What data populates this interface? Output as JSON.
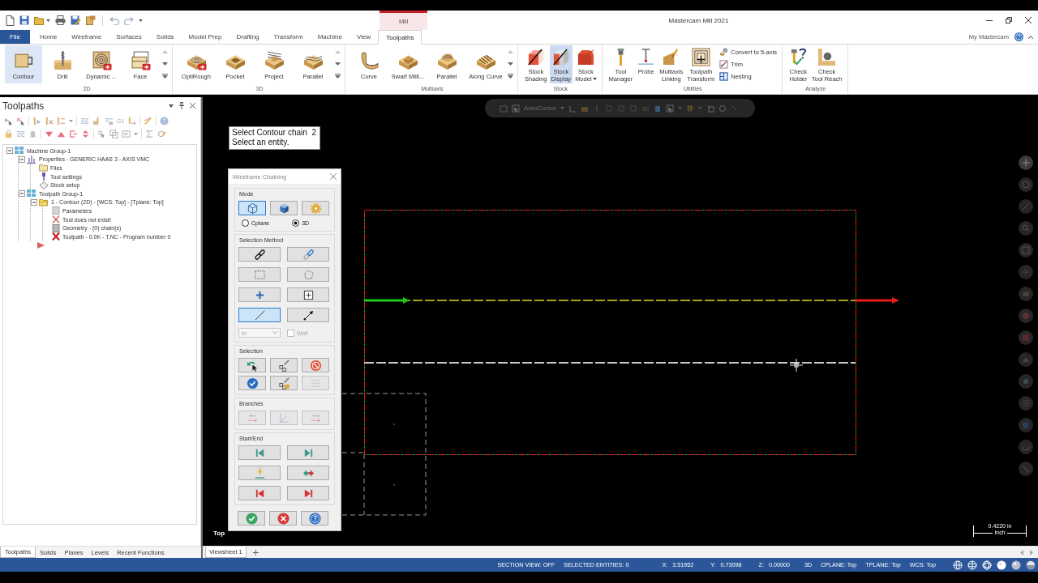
{
  "window": {
    "title": "Mastercam Mill 2021",
    "context_tab": "Mill"
  },
  "ribbon_tabs": [
    {
      "label": "File",
      "kind": "file",
      "selected": false
    },
    {
      "label": "Home",
      "kind": "tab",
      "selected": false
    },
    {
      "label": "Wireframe",
      "kind": "tab",
      "selected": false
    },
    {
      "label": "Surfaces",
      "kind": "tab",
      "selected": false
    },
    {
      "label": "Solids",
      "kind": "tab",
      "selected": false
    },
    {
      "label": "Model Prep",
      "kind": "tab",
      "selected": false
    },
    {
      "label": "Drafting",
      "kind": "tab",
      "selected": false
    },
    {
      "label": "Transform",
      "kind": "tab",
      "selected": false
    },
    {
      "label": "Machine",
      "kind": "tab",
      "selected": false
    },
    {
      "label": "View",
      "kind": "tab",
      "selected": false
    },
    {
      "label": "Toolpaths",
      "kind": "tab",
      "selected": true
    }
  ],
  "account": {
    "label": "My Mastercam"
  },
  "ribbon_groups": [
    {
      "label": "2D",
      "gallery": true,
      "buttons": [
        {
          "label": "Contour",
          "selected": true,
          "dropdown": false
        },
        {
          "label": "Drill",
          "selected": false,
          "dropdown": false
        },
        {
          "label": "Dynamic ...",
          "selected": false,
          "dropdown": false
        },
        {
          "label": "Face",
          "selected": false,
          "dropdown": false
        }
      ]
    },
    {
      "label": "3D",
      "gallery": true,
      "buttons": [
        {
          "label": "OptiRough",
          "selected": false,
          "dropdown": false
        },
        {
          "label": "Pocket",
          "selected": false,
          "dropdown": false
        },
        {
          "label": "Project",
          "selected": false,
          "dropdown": false
        },
        {
          "label": "Parallel",
          "selected": false,
          "dropdown": false
        }
      ]
    },
    {
      "label": "Multiaxis",
      "gallery": true,
      "buttons": [
        {
          "label": "Curve",
          "selected": false,
          "dropdown": false
        },
        {
          "label": "Swarf Milli...",
          "selected": false,
          "dropdown": false
        },
        {
          "label": "Parallel",
          "selected": false,
          "dropdown": false
        },
        {
          "label": "Along Curve",
          "selected": false,
          "dropdown": false
        }
      ]
    },
    {
      "label": "Stock",
      "gallery": false,
      "buttons": [
        {
          "label": "Stock\nShading",
          "selected": false,
          "dropdown": false
        },
        {
          "label": "Stock\nDisplay",
          "selected": true,
          "dropdown": false
        },
        {
          "label": "Stock\nModel",
          "selected": false,
          "dropdown": true
        }
      ]
    },
    {
      "label": "Utilities",
      "gallery": false,
      "buttons": [
        {
          "label": "Tool\nManager",
          "kind": "large",
          "selected": false,
          "dropdown": false
        },
        {
          "label": "Probe",
          "kind": "large",
          "selected": false,
          "dropdown": false
        },
        {
          "label": "Multiaxis\nLinking",
          "kind": "large",
          "selected": false,
          "dropdown": false
        },
        {
          "label": "Toolpath\nTransform",
          "kind": "large",
          "selected": false,
          "dropdown": false
        },
        {
          "label": "Convert to 5-axis",
          "kind": "small",
          "selected": false,
          "dropdown": false
        },
        {
          "label": "Trim",
          "kind": "small",
          "selected": false,
          "dropdown": false
        },
        {
          "label": "Nesting",
          "kind": "small",
          "selected": false,
          "dropdown": false
        }
      ]
    },
    {
      "label": "Analyze",
      "gallery": false,
      "buttons": [
        {
          "label": "Check\nHolder",
          "selected": false,
          "dropdown": false
        },
        {
          "label": "Check\nTool Reach",
          "selected": false,
          "dropdown": false
        }
      ]
    }
  ],
  "toolpaths_panel": {
    "title": "Toolpaths",
    "post_label": "G1",
    "tree": [
      {
        "label": "Machine Group-1",
        "kind": "machine-group",
        "expanded": true,
        "children": [
          {
            "label": "Properties - GENERIC HAAS 3 - AXIS VMC",
            "kind": "properties",
            "expanded": true,
            "children": [
              {
                "label": "Files",
                "kind": "folder"
              },
              {
                "label": "Tool settings",
                "kind": "tool-settings"
              },
              {
                "label": "Stock setup",
                "kind": "stock"
              }
            ]
          },
          {
            "label": "Toolpath Group-1",
            "kind": "toolpath-group",
            "expanded": true,
            "children": [
              {
                "label": "1 - Contour (2D) - [WCS: Top] - [Tplane: Top]",
                "kind": "operation",
                "expanded": true,
                "children": [
                  {
                    "label": "Parameters",
                    "kind": "parameters"
                  },
                  {
                    "label": "Tool does not exist!",
                    "kind": "missing-tool"
                  },
                  {
                    "label": "Geometry - (0) chain(s)",
                    "kind": "geometry"
                  },
                  {
                    "label": "Toolpath - 0.0K - T.NC - Program number 0",
                    "kind": "toolpath"
                  }
                ]
              }
            ]
          }
        ]
      }
    ]
  },
  "panel_tabs": [
    {
      "label": "Toolpaths",
      "selected": true
    },
    {
      "label": "Solids",
      "selected": false
    },
    {
      "label": "Planes",
      "selected": false
    },
    {
      "label": "Levels",
      "selected": false
    },
    {
      "label": "Recent Functions",
      "selected": false
    }
  ],
  "prompt": {
    "lines": [
      "Select Contour chain  2",
      "Select an entity."
    ]
  },
  "chaining_dialog": {
    "title": "Wireframe Chaining",
    "sections": [
      {
        "kind": "mode",
        "label": "Mode",
        "buttons": [
          {
            "selected": true
          },
          {
            "selected": false
          },
          {
            "selected": false
          }
        ],
        "options": [
          {
            "label": "Cplane",
            "selected": false
          },
          {
            "label": "3D",
            "selected": true
          }
        ]
      },
      {
        "kind": "method",
        "label": "Selection Method",
        "buttons": [
          {
            "selected": false
          },
          {
            "selected": false
          },
          {
            "selected": false
          },
          {
            "selected": false
          },
          {
            "selected": false
          },
          {
            "selected": false
          },
          {
            "selected": true
          },
          {
            "selected": false
          }
        ],
        "dropdown": {
          "value": "In",
          "disabled": true
        },
        "wait": {
          "label": "Wait",
          "checked": false,
          "disabled": true
        }
      },
      {
        "kind": "selection",
        "label": "Selection",
        "buttons": [
          {
            "disabled": false
          },
          {
            "disabled": false
          },
          {
            "disabled": false
          },
          {
            "disabled": false
          },
          {
            "disabled": false
          },
          {
            "disabled": true
          }
        ]
      },
      {
        "kind": "branches",
        "label": "Branches",
        "buttons": [
          {
            "disabled": true
          },
          {
            "disabled": true
          },
          {
            "disabled": true
          }
        ]
      },
      {
        "kind": "start_end",
        "label": "Start/End",
        "buttons": [
          {
            "disabled": false
          },
          {
            "disabled": false
          },
          {
            "disabled": false
          },
          {
            "disabled": false
          },
          {
            "disabled": false
          },
          {
            "disabled": false
          }
        ]
      }
    ]
  },
  "autocursor": {
    "label": "AutoCursor"
  },
  "view_label": "Top",
  "scale": {
    "value": "0.4220 in",
    "unit": "Inch"
  },
  "viewsheet_tabs": [
    {
      "label": "Viewsheet 1",
      "selected": true
    }
  ],
  "status_bar": {
    "items": [
      {
        "kind": "text",
        "label": "SECTION VIEW: OFF"
      },
      {
        "kind": "text",
        "label": "SELECTED ENTITIES: 0"
      },
      {
        "kind": "coord",
        "label": "X:",
        "value": "3.51952"
      },
      {
        "kind": "coord",
        "label": "Y:",
        "value": "0.73098"
      },
      {
        "kind": "coord",
        "label": "Z:",
        "value": "0.00000"
      },
      {
        "kind": "text",
        "label": "3D"
      },
      {
        "kind": "text",
        "label": "CPLANE: Top"
      },
      {
        "kind": "text",
        "label": "TPLANE: Top"
      },
      {
        "kind": "text",
        "label": "WCS: Top"
      }
    ]
  }
}
